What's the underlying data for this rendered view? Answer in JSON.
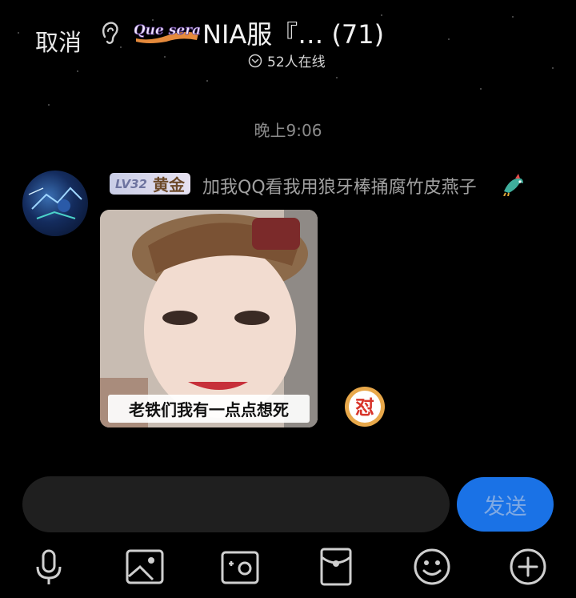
{
  "header": {
    "cancel_label": "取消",
    "logo_text": "Que sera",
    "title": "NIA服『… (71)",
    "online_text": "52人在线"
  },
  "chat": {
    "timestamp": "晚上9:06",
    "message": {
      "level": "LV32",
      "rank": "黄金",
      "nickname": "加我QQ看我用狼牙棒捅腐竹皮燕子",
      "meme_caption": "老铁们我有一点点想死",
      "badge_char": "怼"
    }
  },
  "composer": {
    "input_value": "",
    "send_label": "发送"
  },
  "toolbar": {
    "items": [
      "microphone-icon",
      "image-icon",
      "camera-icon",
      "red-envelope-icon",
      "emoji-icon",
      "plus-icon"
    ]
  },
  "colors": {
    "background": "#000000",
    "send_button": "#1a72e6",
    "input_bg": "#1f1f1f"
  }
}
